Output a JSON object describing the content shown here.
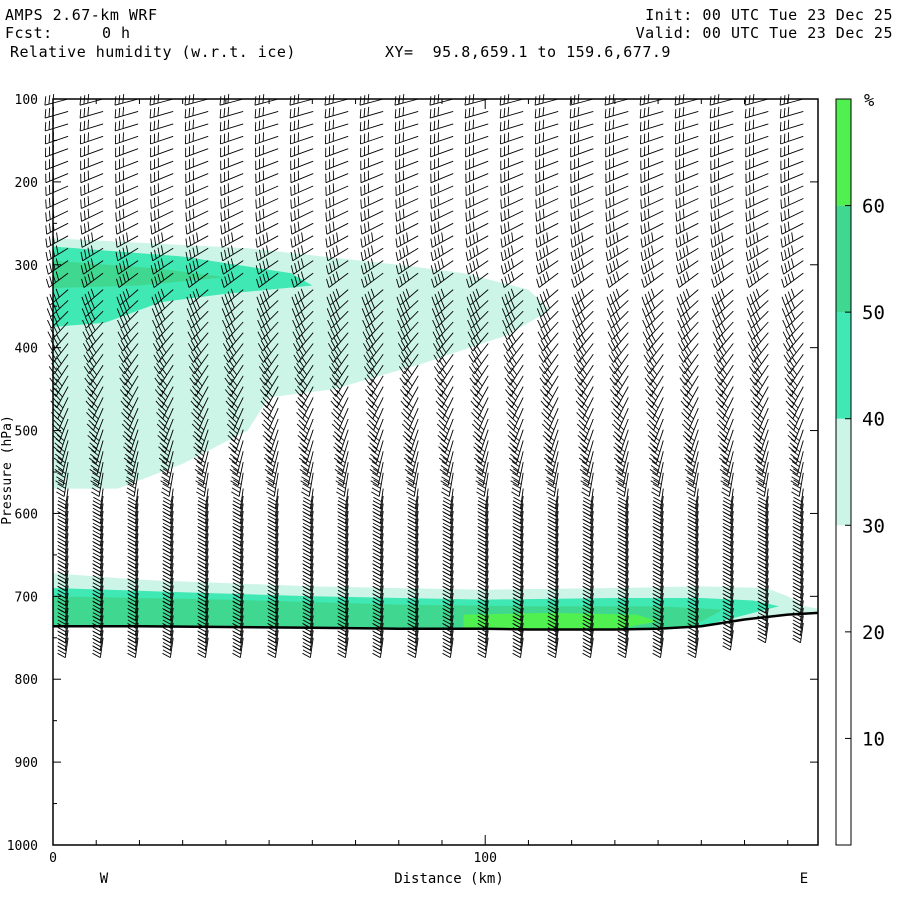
{
  "header": {
    "model": "AMPS 2.67-km WRF",
    "fcst_label": "Fcst:",
    "fcst_value": "0 h",
    "field": "Relative humidity (w.r.t. ice)",
    "xy": "XY=  95.8,659.1 to 159.6,677.9",
    "init": "Init: 00 UTC Tue 23 Dec 25",
    "valid": "Valid: 00 UTC Tue 23 Dec 25"
  },
  "chart_data": {
    "type": "heatmap",
    "xlabel": "Distance (km)",
    "ylabel": "Pressure (hPa)",
    "xlim": [
      0,
      177
    ],
    "ylim": [
      1000,
      100
    ],
    "y_scale": "linear (pressure decreasing upward)",
    "x_ticks": [
      0,
      100
    ],
    "y_ticks": [
      100,
      200,
      300,
      400,
      500,
      600,
      700,
      800,
      900,
      1000
    ],
    "direction_labels": {
      "left": "W",
      "right": "E"
    },
    "colorbar": {
      "unit": "%",
      "tick_labels": [
        10,
        20,
        30,
        40,
        50,
        60
      ],
      "bins": [
        {
          "from": 0,
          "to": 30,
          "color": "#ffffff"
        },
        {
          "from": 30,
          "to": 40,
          "color": "#ccf5e8"
        },
        {
          "from": 40,
          "to": 50,
          "color": "#40e8b4"
        },
        {
          "from": 50,
          "to": 60,
          "color": "#40d890"
        },
        {
          "from": 60,
          "to": 70,
          "color": "#50f050"
        }
      ]
    },
    "terrain_pressure": {
      "x": [
        0,
        20,
        40,
        60,
        80,
        100,
        110,
        120,
        130,
        140,
        150,
        160,
        170,
        177
      ],
      "hPa": [
        736,
        736,
        737,
        738,
        739,
        739,
        740,
        740,
        740,
        739,
        736,
        728,
        722,
        720
      ]
    },
    "barbs": "wind barbs plotted at every model level along every column",
    "grid": false,
    "legend": "colorbar-right"
  }
}
